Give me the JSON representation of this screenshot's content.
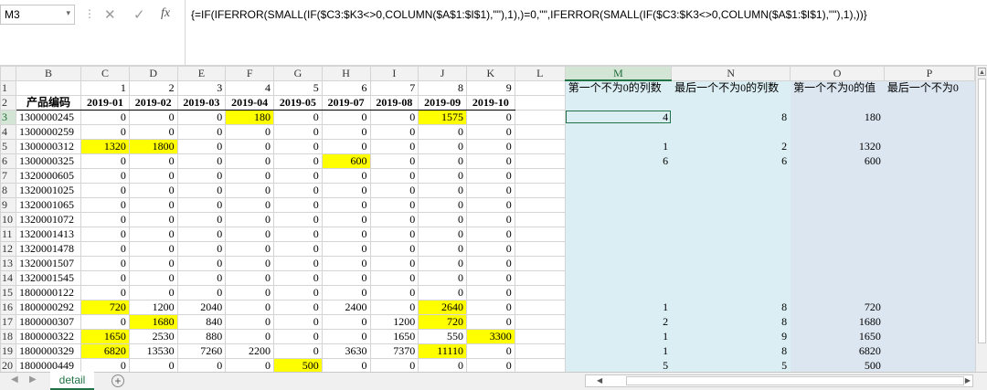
{
  "name_box": "M3",
  "formula": "{=IF(IFERROR(SMALL(IF($C3:$K3<>0,COLUMN($A$1:$I$1),\"\"),1),)=0,\"\",IFERROR(SMALL(IF($C3:$K3<>0,COLUMN($A$1:$I$1),\"\"),1),))}",
  "formula_icons": {
    "cancel": "✕",
    "enter": "✓",
    "fx": "fx",
    "separator": "⋮",
    "dropdown": "▾"
  },
  "columns": [
    "A",
    "B",
    "C",
    "D",
    "E",
    "F",
    "G",
    "H",
    "I",
    "J",
    "K",
    "L",
    "M",
    "N",
    "O",
    "P"
  ],
  "rows": [
    {
      "n": "1",
      "B": "",
      "nums": [
        "1",
        "2",
        "3",
        "4",
        "5",
        "6",
        "7",
        "8",
        "9"
      ],
      "M": "第一个不为0的列数",
      "N": "最后一个不为0的列数",
      "O": "第一个不为0的值",
      "P": "最后一个不为0"
    },
    {
      "n": "2",
      "B": "产品编码",
      "nums": [
        "2019-01",
        "2019-02",
        "2019-03",
        "2019-04",
        "2019-05",
        "2019-07",
        "2019-08",
        "2019-09",
        "2019-10"
      ],
      "M": "",
      "N": "",
      "O": "",
      "P": ""
    },
    {
      "n": "3",
      "B": "1300000245",
      "nums": [
        "0",
        "0",
        "0",
        "180",
        "0",
        "0",
        "0",
        "1575",
        "0"
      ],
      "hl": [
        3,
        7
      ],
      "M": "4",
      "N": "8",
      "O": "180",
      "P": ""
    },
    {
      "n": "4",
      "B": "1300000259",
      "nums": [
        "0",
        "0",
        "0",
        "0",
        "0",
        "0",
        "0",
        "0",
        "0"
      ],
      "M": "",
      "N": "",
      "O": "",
      "P": ""
    },
    {
      "n": "5",
      "B": "1300000312",
      "nums": [
        "1320",
        "1800",
        "0",
        "0",
        "0",
        "0",
        "0",
        "0",
        "0"
      ],
      "hl": [
        0,
        1
      ],
      "M": "1",
      "N": "2",
      "O": "1320",
      "P": ""
    },
    {
      "n": "6",
      "B": "1300000325",
      "nums": [
        "0",
        "0",
        "0",
        "0",
        "0",
        "600",
        "0",
        "0",
        "0"
      ],
      "hl": [
        5
      ],
      "M": "6",
      "N": "6",
      "O": "600",
      "P": ""
    },
    {
      "n": "7",
      "B": "1320000605",
      "nums": [
        "0",
        "0",
        "0",
        "0",
        "0",
        "0",
        "0",
        "0",
        "0"
      ],
      "M": "",
      "N": "",
      "O": "",
      "P": ""
    },
    {
      "n": "8",
      "B": "1320001025",
      "nums": [
        "0",
        "0",
        "0",
        "0",
        "0",
        "0",
        "0",
        "0",
        "0"
      ],
      "M": "",
      "N": "",
      "O": "",
      "P": ""
    },
    {
      "n": "9",
      "B": "1320001065",
      "nums": [
        "0",
        "0",
        "0",
        "0",
        "0",
        "0",
        "0",
        "0",
        "0"
      ],
      "M": "",
      "N": "",
      "O": "",
      "P": ""
    },
    {
      "n": "10",
      "B": "1320001072",
      "nums": [
        "0",
        "0",
        "0",
        "0",
        "0",
        "0",
        "0",
        "0",
        "0"
      ],
      "M": "",
      "N": "",
      "O": "",
      "P": ""
    },
    {
      "n": "11",
      "B": "1320001413",
      "nums": [
        "0",
        "0",
        "0",
        "0",
        "0",
        "0",
        "0",
        "0",
        "0"
      ],
      "M": "",
      "N": "",
      "O": "",
      "P": ""
    },
    {
      "n": "12",
      "B": "1320001478",
      "nums": [
        "0",
        "0",
        "0",
        "0",
        "0",
        "0",
        "0",
        "0",
        "0"
      ],
      "M": "",
      "N": "",
      "O": "",
      "P": ""
    },
    {
      "n": "13",
      "B": "1320001507",
      "nums": [
        "0",
        "0",
        "0",
        "0",
        "0",
        "0",
        "0",
        "0",
        "0"
      ],
      "M": "",
      "N": "",
      "O": "",
      "P": ""
    },
    {
      "n": "14",
      "B": "1320001545",
      "nums": [
        "0",
        "0",
        "0",
        "0",
        "0",
        "0",
        "0",
        "0",
        "0"
      ],
      "M": "",
      "N": "",
      "O": "",
      "P": ""
    },
    {
      "n": "15",
      "B": "1800000122",
      "nums": [
        "0",
        "0",
        "0",
        "0",
        "0",
        "0",
        "0",
        "0",
        "0"
      ],
      "M": "",
      "N": "",
      "O": "",
      "P": ""
    },
    {
      "n": "16",
      "B": "1800000292",
      "nums": [
        "720",
        "1200",
        "2040",
        "0",
        "0",
        "2400",
        "0",
        "2640",
        "0"
      ],
      "hl": [
        0,
        7
      ],
      "M": "1",
      "N": "8",
      "O": "720",
      "P": ""
    },
    {
      "n": "17",
      "B": "1800000307",
      "nums": [
        "0",
        "1680",
        "840",
        "0",
        "0",
        "0",
        "1200",
        "720",
        "0"
      ],
      "hl": [
        1,
        7
      ],
      "M": "2",
      "N": "8",
      "O": "1680",
      "P": ""
    },
    {
      "n": "18",
      "B": "1800000322",
      "nums": [
        "1650",
        "2530",
        "880",
        "0",
        "0",
        "0",
        "1650",
        "550",
        "3300"
      ],
      "hl": [
        0,
        8
      ],
      "M": "1",
      "N": "9",
      "O": "1650",
      "P": ""
    },
    {
      "n": "19",
      "B": "1800000329",
      "nums": [
        "6820",
        "13530",
        "7260",
        "2200",
        "0",
        "3630",
        "7370",
        "11110",
        "0"
      ],
      "hl": [
        0,
        7
      ],
      "M": "1",
      "N": "8",
      "O": "6820",
      "P": ""
    },
    {
      "n": "20",
      "B": "1800000449",
      "nums": [
        "0",
        "0",
        "0",
        "0",
        "500",
        "0",
        "0",
        "0",
        "0"
      ],
      "hl": [
        4
      ],
      "M": "5",
      "N": "5",
      "O": "500",
      "P": ""
    }
  ],
  "sheet_tab": "detail",
  "add_sheet": "+",
  "colors": {
    "highlight": "#ffff00",
    "col_m_n_fill": "#daeef3",
    "col_o_p_fill": "#dce6f1",
    "accent": "#217346"
  }
}
